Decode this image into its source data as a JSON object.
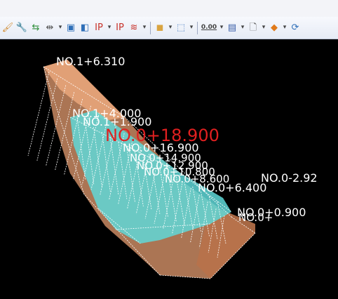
{
  "toolbar": {
    "icons": [
      {
        "name": "paint-icon",
        "glyph": "🖌",
        "color": "#d28a2e"
      },
      {
        "name": "wrench-icon",
        "glyph": "🔧",
        "color": "#6e7aa8"
      },
      {
        "name": "swap-arrows-icon",
        "glyph": "⇆",
        "color": "#2f8f3a"
      },
      {
        "name": "align-icon",
        "glyph": "⇹",
        "color": "#555"
      },
      {
        "name": "dropdown",
        "glyph": "▾",
        "color": "#444"
      },
      {
        "name": "image-icon",
        "glyph": "▣",
        "color": "#2f6fb8"
      },
      {
        "name": "frame-icon",
        "glyph": "◧",
        "color": "#2f6fb8"
      },
      {
        "name": "ip-icon",
        "glyph": "IP",
        "color": "#c8322a"
      },
      {
        "name": "dropdown",
        "glyph": "▾",
        "color": "#444"
      },
      {
        "name": "ip-bold-icon",
        "glyph": "IP",
        "color": "#c8322a"
      },
      {
        "name": "wave-icon",
        "glyph": "≋",
        "color": "#c8322a"
      },
      {
        "name": "dropdown",
        "glyph": "▾",
        "color": "#444"
      },
      {
        "name": "separator",
        "glyph": "",
        "color": ""
      },
      {
        "name": "box-icon",
        "glyph": "◼",
        "color": "#d9a441"
      },
      {
        "name": "dropdown",
        "glyph": "▾",
        "color": "#444"
      },
      {
        "name": "cube-icon",
        "glyph": "⬚",
        "color": "#4b7fc4"
      },
      {
        "name": "dropdown",
        "glyph": "▾",
        "color": "#444"
      },
      {
        "name": "separator",
        "glyph": "",
        "color": ""
      },
      {
        "name": "decimal-icon",
        "glyph": "0.00",
        "color": "#444"
      },
      {
        "name": "dropdown",
        "glyph": "▾",
        "color": "#444"
      },
      {
        "name": "window-icon",
        "glyph": "▤",
        "color": "#3a5ea8"
      },
      {
        "name": "dropdown",
        "glyph": "▾",
        "color": "#444"
      },
      {
        "name": "page-icon",
        "glyph": "🗋",
        "color": "#555"
      },
      {
        "name": "dropdown",
        "glyph": "▾",
        "color": "#444"
      },
      {
        "name": "diamond-icon",
        "glyph": "◆",
        "color": "#e07a1a"
      },
      {
        "name": "dropdown",
        "glyph": "▾",
        "color": "#444"
      },
      {
        "name": "refresh-icon",
        "glyph": "⟳",
        "color": "#2f6fb8"
      }
    ]
  },
  "viewport": {
    "labels": [
      {
        "text": "NO.1+6.310",
        "color": "#ffffff"
      },
      {
        "text": "NO.1+4.000",
        "color": "#ffffff"
      },
      {
        "text": "NO.1+1.900",
        "color": "#ffffff"
      },
      {
        "text": "NO.0+18.900",
        "color": "#e02020"
      },
      {
        "text": "NO.0+16.900",
        "color": "#ffffff"
      },
      {
        "text": "NO.0+14.900",
        "color": "#ffffff"
      },
      {
        "text": "NO.0+12.900",
        "color": "#ffffff"
      },
      {
        "text": "NO.0+10.800",
        "color": "#ffffff"
      },
      {
        "text": "NO.0+8.600",
        "color": "#ffffff"
      },
      {
        "text": "NO.0+6.400",
        "color": "#ffffff"
      },
      {
        "text": "NO.0-2.92",
        "color": "#ffffff"
      },
      {
        "text": "NO.0+0.900",
        "color": "#ffffff"
      },
      {
        "text": "NO.0+",
        "color": "#ffffff"
      }
    ],
    "colors": {
      "mesh": "#ffffff",
      "outer": "#e7a57a",
      "water": "#5fd8d8",
      "background": "#000000"
    }
  }
}
